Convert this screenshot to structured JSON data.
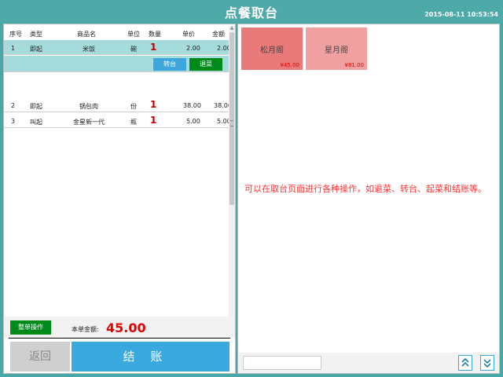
{
  "header": {
    "title": "点餐取台",
    "datetime": "2015-08-11 10:53:54"
  },
  "order_table": {
    "columns": [
      "序号",
      "类型",
      "商品名",
      "单位",
      "数量",
      "单价",
      "金额"
    ],
    "rows": [
      {
        "no": "1",
        "type": "即起",
        "name": "米饭",
        "unit": "碗",
        "qty": "1",
        "price": "2.00",
        "amount": "2.00",
        "selected": true
      },
      {
        "no": "2",
        "type": "即起",
        "name": "锅包肉",
        "unit": "份",
        "qty": "1",
        "price": "38.00",
        "amount": "38.00",
        "selected": false
      },
      {
        "no": "3",
        "type": "叫起",
        "name": "金星新一代",
        "unit": "瓶",
        "qty": "1",
        "price": "5.00",
        "amount": "5.00",
        "selected": false
      }
    ],
    "row_actions": {
      "transfer_label": "转台",
      "return_label": "退菜"
    }
  },
  "summary": {
    "whole_order_label": "整单操作",
    "total_label": "本单金额:",
    "total_value": "45.00"
  },
  "footer": {
    "back_label": "返回",
    "checkout_label": "结账"
  },
  "tables": [
    {
      "name": "松月阁",
      "price": "¥45.00",
      "color": "#e97a7a"
    },
    {
      "name": "星月阁",
      "price": "¥81.00",
      "color": "#f0a0a0"
    }
  ],
  "hint_text": "可以在取台页面进行各种操作，如退菜、转台、起菜和结账等。",
  "search": {
    "value": "",
    "placeholder": ""
  },
  "pager": {
    "up_icon": "double-chevron-up-icon",
    "down_icon": "double-chevron-down-icon"
  },
  "colors": {
    "title_bar": "#4ea9a9",
    "selected_row": "#a6dbdb",
    "green_button": "#008a1a",
    "blue_button": "#3aa9e0",
    "total_red": "#e00000"
  }
}
